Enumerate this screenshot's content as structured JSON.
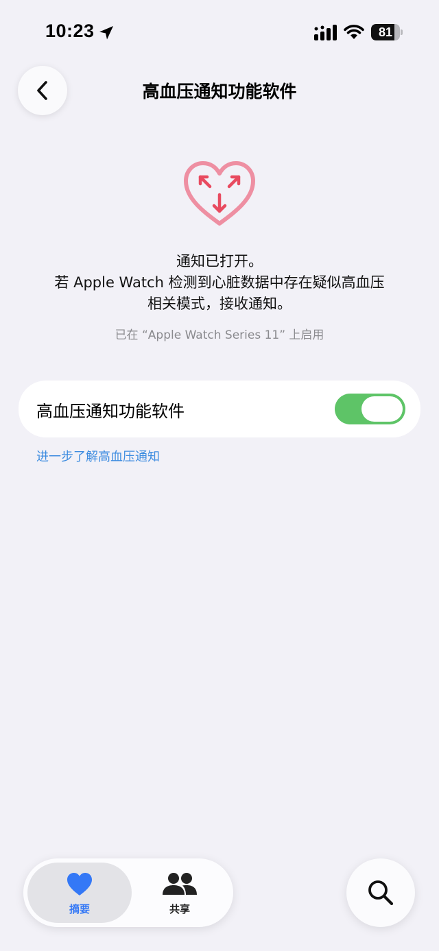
{
  "status_bar": {
    "time": "10:23",
    "battery": "81",
    "battery_level": 0.81,
    "icons": [
      "location-arrow-icon",
      "signal-icon",
      "wifi-icon",
      "battery-icon"
    ]
  },
  "nav": {
    "back_icon": "chevron-left-icon",
    "title": "高血压通知功能软件"
  },
  "hero": {
    "icon": "heart-arrows-icon",
    "line1": "通知已打开。",
    "line2": "若 Apple Watch 检测到心脏数据中存在疑似高血压",
    "line3": "相关模式，接收通知。",
    "enabled_on": "已在 “Apple Watch Series 11” 上启用"
  },
  "setting": {
    "label": "高血压通知功能软件",
    "enabled": true
  },
  "learn_more": "进一步了解高血压通知",
  "tab_bar": {
    "tabs": [
      {
        "label": "摘要",
        "icon": "heart-icon",
        "selected": true
      },
      {
        "label": "共享",
        "icon": "people-icon",
        "selected": false
      }
    ]
  },
  "search_icon": "search-icon",
  "colors": {
    "background": "#f2f1f7",
    "accent": "#3478f6",
    "link": "#3d8ce0",
    "toggle_on": "#5ec467",
    "heart_outline": "#ee8fa2",
    "heart_arrows": "#e84a5f"
  }
}
